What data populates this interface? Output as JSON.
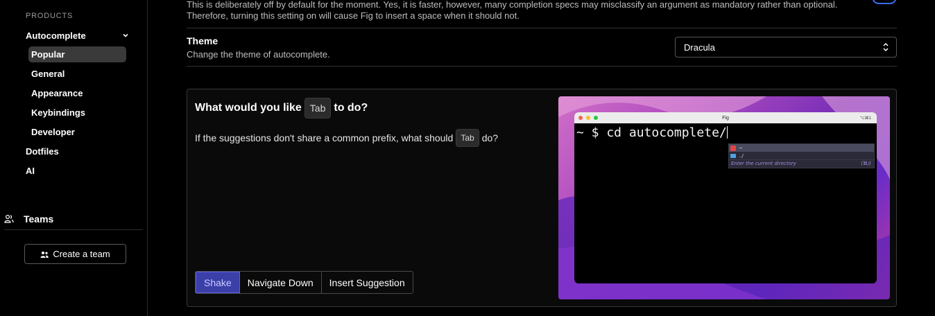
{
  "sidebar": {
    "section_label": "PRODUCTS",
    "autocomplete": {
      "label": "Autocomplete"
    },
    "sub_items": [
      {
        "label": "Popular",
        "active": true
      },
      {
        "label": "General"
      },
      {
        "label": "Appearance"
      },
      {
        "label": "Keybindings"
      },
      {
        "label": "Developer"
      }
    ],
    "top_items": [
      {
        "label": "Dotfiles"
      },
      {
        "label": "AI"
      }
    ],
    "teams_label": "Teams",
    "create_team_label": "Create a team"
  },
  "main": {
    "top_description": "This is deliberately off by default for the moment. Yes, it is faster, however, many completion specs may misclassify an argument as mandatory rather than optional. Therefore, turning this setting on will cause Fig to insert a space when it should not.",
    "theme": {
      "title": "Theme",
      "description": "Change the theme of autocomplete.",
      "selected": "Dracula"
    },
    "tab_setting": {
      "title_before": "What would you like",
      "title_key": "Tab",
      "title_after": "to do?",
      "desc_before": "If the suggestions don't share a common prefix, what should",
      "desc_key": "Tab",
      "desc_after": "do?",
      "options": [
        {
          "label": "Shake",
          "active": true
        },
        {
          "label": "Navigate Down"
        },
        {
          "label": "Insert Suggestion"
        }
      ]
    },
    "preview": {
      "window_title": "Fig",
      "shortcut": "⌥⌘1",
      "prompt": "~ $ cd autocomplete/",
      "suggestion_1": "~",
      "suggestion_2": "../",
      "suggestion_desc": "Enter the current directory",
      "suggestion_hint": "(⌘/)"
    }
  },
  "colors": {
    "accent": "#3b3fa8",
    "toggle": "#3a6cf0",
    "sidebar_active": "#3a3a3a"
  }
}
